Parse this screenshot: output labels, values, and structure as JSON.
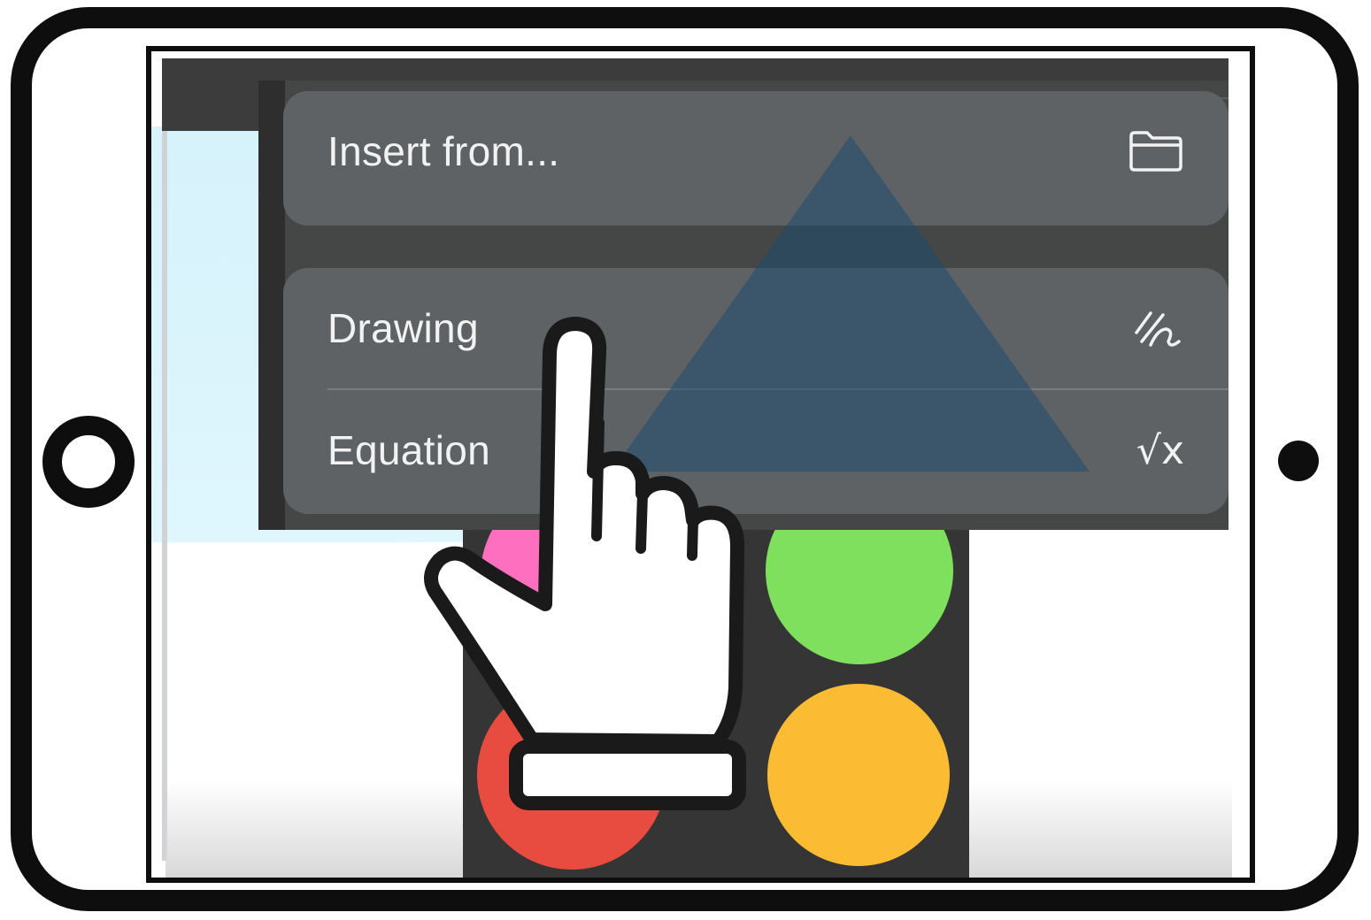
{
  "menu": {
    "items": [
      {
        "label": "Insert from...",
        "icon": "folder-icon"
      },
      {
        "label": "Drawing",
        "icon": "scribble-pen-icon"
      },
      {
        "label": "Equation",
        "icon": "square-root-x-icon"
      }
    ],
    "equation_icon_text": "√x"
  },
  "swatches": [
    {
      "name": "pink",
      "color": "#ff6fbf"
    },
    {
      "name": "green",
      "color": "#7fe05e"
    },
    {
      "name": "red",
      "color": "#e84b3f"
    },
    {
      "name": "yellow",
      "color": "#fbbb32"
    }
  ],
  "overlay": {
    "hand": "pointing-hand-icon",
    "shape": "triangle-shape"
  }
}
